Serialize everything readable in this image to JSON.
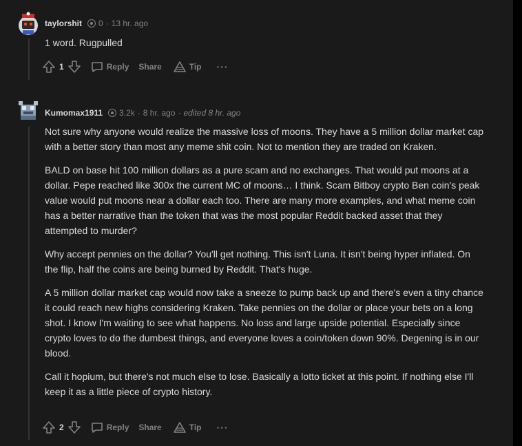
{
  "comments": [
    {
      "username": "taylorshit",
      "karma": "0",
      "time": "13 hr. ago",
      "edited": "",
      "paragraphs": [
        "1 word. Rugpulled"
      ],
      "score": "1",
      "actions": {
        "reply": "Reply",
        "share": "Share",
        "tip": "Tip",
        "more": "···"
      }
    },
    {
      "username": "Kumomax1911",
      "karma": "3.2k",
      "time": "8 hr. ago",
      "edited": "edited 8 hr. ago",
      "paragraphs": [
        "Not sure why anyone would realize the massive loss of moons. They have a 5 million dollar market cap with a better story than most any meme shit coin. Not to mention they are traded on Kraken.",
        "BALD on base hit 100 million dollars as a pure scam and no exchanges. That would put moons at a dollar. Pepe reached like 300x the current MC of moons… I think. Scam Bitboy crypto Ben coin's peak value would put moons near a dollar each too. There are many more examples, and what meme coin has a better narrative than the token that was the most popular Reddit backed asset that they attempted to murder?",
        "Why accept pennies on the dollar? You'll get nothing. This isn't Luna. It isn't being hyper inflated. On the flip, half the coins are being burned by Reddit. That's huge.",
        "A 5 million dollar market cap would now take a sneeze to pump back up and there's even a tiny chance it could reach new highs considering Kraken. Take pennies on the dollar or place your bets on a long shot. I know I'm waiting to see what happens. No loss and large upside potential. Especially since crypto loves to do the dumbest things, and everyone loves a coin/token down 90%. Degening is in our blood.",
        "Call it hopium, but there's not much else to lose. Basically a lotto ticket at this point. If nothing else I'll keep it as a little piece of crypto history."
      ],
      "score": "2",
      "actions": {
        "reply": "Reply",
        "share": "Share",
        "tip": "Tip",
        "more": "···"
      }
    }
  ],
  "colors": {
    "background": "#1a1a1b",
    "text": "#d7dadc",
    "muted": "#818384"
  },
  "icons": [
    "upvote-icon",
    "downvote-icon",
    "reply-icon",
    "tip-icon",
    "karma-icon",
    "more-icon"
  ]
}
